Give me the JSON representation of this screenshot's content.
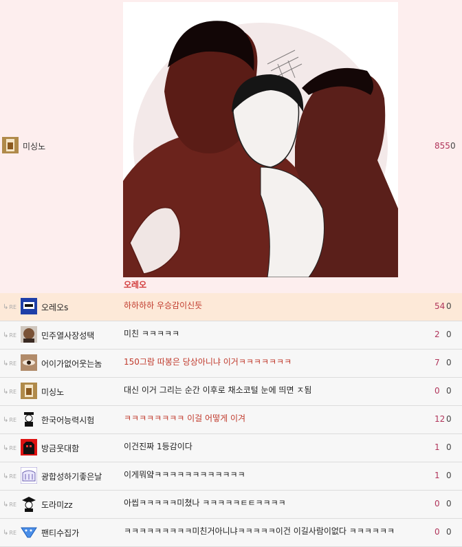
{
  "post": {
    "nickname": "미싱노",
    "caption": "오레오",
    "count": "855",
    "zero": "0"
  },
  "comments": [
    {
      "nickname": "오레오s",
      "text": "하하하하 우승감이신듯",
      "count": "54",
      "zero": "0"
    },
    {
      "nickname": "민주열사장성택",
      "text": "미친 ㅋㅋㅋㅋㅋ",
      "count": "2",
      "zero": "0"
    },
    {
      "nickname": "어이가없어웃는놈",
      "text": "150그람 따봉은 당상아니냐 이거ㅋㅋㅋㅋㅋㅋㅋ",
      "count": "7",
      "zero": "0"
    },
    {
      "nickname": "미싱노",
      "text": "대신 이거 그리는 순간 이후로 채소코털 눈에 띄면 ㅈ됨",
      "count": "0",
      "zero": "0"
    },
    {
      "nickname": "한국어능력시험",
      "text": "ㅋㅋㅋㅋㅋㅋㅋㅋ 이걸 어떻게 이겨",
      "count": "12",
      "zero": "0"
    },
    {
      "nickname": "방금웃대함",
      "text": "이건진짜 1등감이다",
      "count": "1",
      "zero": "0"
    },
    {
      "nickname": "광합성하기좋은날",
      "text": "이게뭐얔ㅋㅋㅋㅋㅋㅋㅋㅋㅋㅋㅋㅋ",
      "count": "1",
      "zero": "0"
    },
    {
      "nickname": "도라미zz",
      "text": "아씹ㅋㅋㅋㅋㅋ미쳤나 ㅋㅋㅋㅋㅋㅌㅌㅋㅋㅋㅋ",
      "count": "0",
      "zero": "0"
    },
    {
      "nickname": "팬티수집가",
      "text": "ㅋㅋㅋㅋㅋㅋㅋㅋㅋ미친거아니냐ㅋㅋㅋㅋㅋ이건 이길사람이없다 ㅋㅋㅋㅋㅋㅋ",
      "count": "0",
      "zero": "0"
    }
  ],
  "re_label": "RE",
  "colors": {
    "post_bg": "#fdeeee",
    "highlight_bg": "#fde9d8",
    "row_bg": "#f7f7f7",
    "count": "#b0345a",
    "red_text": "#c0392b"
  }
}
